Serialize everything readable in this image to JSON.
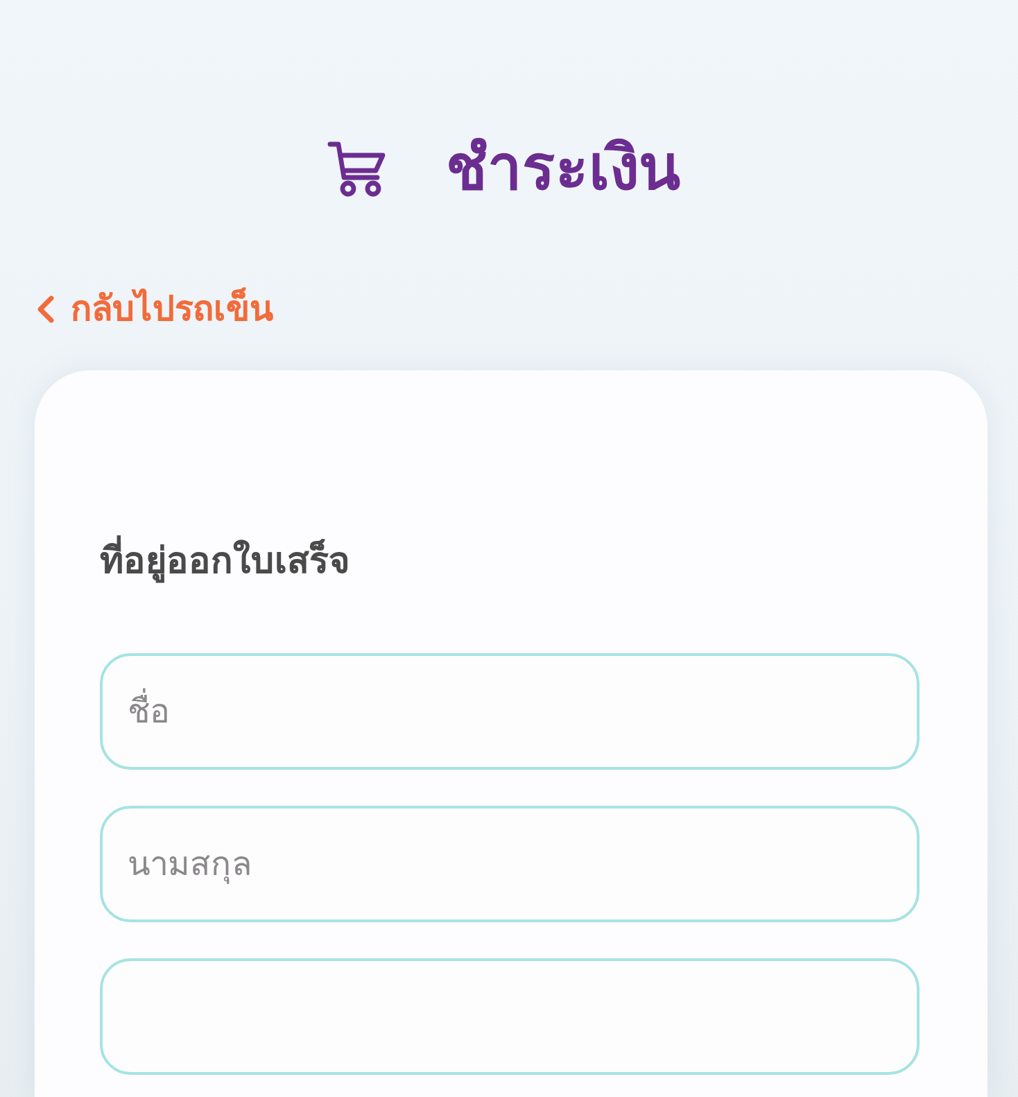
{
  "header": {
    "title": "ชำระเงิน"
  },
  "back_link": {
    "label": "กลับไปรถเข็น"
  },
  "billing_form": {
    "heading": "ที่อยู่ออกใบเสร็จ",
    "fields": [
      {
        "kind": "text",
        "placeholder": "ชื่อ"
      },
      {
        "kind": "text",
        "placeholder": "นามสกุล"
      },
      {
        "kind": "text"
      }
    ]
  }
}
